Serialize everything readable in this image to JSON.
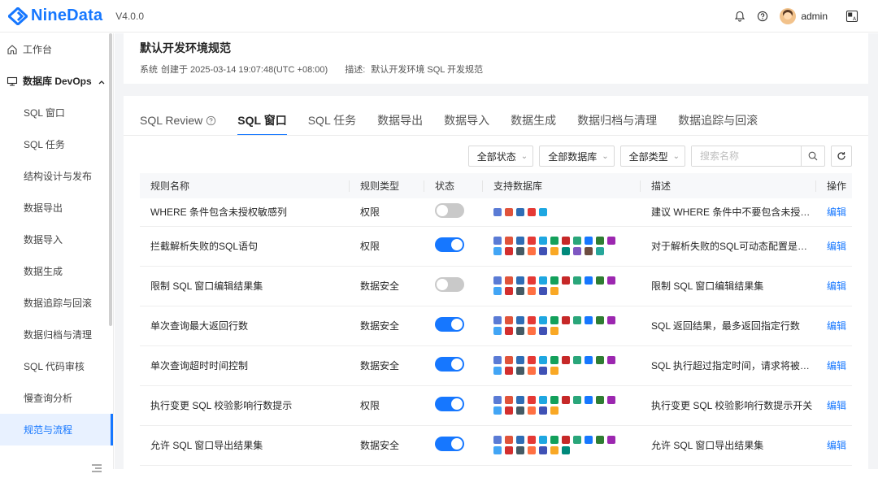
{
  "app": {
    "brand": "NineData",
    "version": "V4.0.0"
  },
  "header": {
    "user": "admin"
  },
  "sidebar": {
    "items": [
      {
        "label": "工作台",
        "level": 1
      },
      {
        "label": "数据库 DevOps",
        "level": 1,
        "expanded": true
      },
      {
        "label": "SQL 窗口",
        "level": 2
      },
      {
        "label": "SQL 任务",
        "level": 2
      },
      {
        "label": "结构设计与发布",
        "level": 2
      },
      {
        "label": "数据导出",
        "level": 2
      },
      {
        "label": "数据导入",
        "level": 2
      },
      {
        "label": "数据生成",
        "level": 2
      },
      {
        "label": "数据追踪与回滚",
        "level": 2
      },
      {
        "label": "数据归档与清理",
        "level": 2
      },
      {
        "label": "SQL 代码审核",
        "level": 2
      },
      {
        "label": "慢查询分析",
        "level": 2
      },
      {
        "label": "规范与流程",
        "level": 2,
        "active": true
      }
    ]
  },
  "spec": {
    "title": "默认开发环境规范",
    "creator": "系统",
    "created_at": "创建于 2025-03-14 19:07:48(UTC +08:00)",
    "desc_label": "描述:",
    "desc": "默认开发环境 SQL 开发规范"
  },
  "tabs": [
    {
      "label": "SQL Review",
      "help": true
    },
    {
      "label": "SQL 窗口",
      "active": true
    },
    {
      "label": "SQL 任务"
    },
    {
      "label": "数据导出"
    },
    {
      "label": "数据导入"
    },
    {
      "label": "数据生成"
    },
    {
      "label": "数据归档与清理"
    },
    {
      "label": "数据追踪与回滚"
    }
  ],
  "filters": {
    "status": "全部状态",
    "database": "全部数据库",
    "type": "全部类型",
    "search_placeholder": "搜索名称"
  },
  "table": {
    "columns": [
      "规则名称",
      "规则类型",
      "状态",
      "支持数据库",
      "描述",
      "操作"
    ],
    "rows": [
      {
        "name": "WHERE 条件包含未授权敏感列",
        "type": "权限",
        "enabled": false,
        "db_count": 5,
        "desc": "建议 WHERE 条件中不要包含未授权...",
        "action": "编辑"
      },
      {
        "name": "拦截解析失败的SQL语句",
        "type": "权限",
        "enabled": true,
        "db_count": 21,
        "desc": "对于解析失败的SQL可动态配置是否...",
        "action": "编辑"
      },
      {
        "name": "限制 SQL 窗口编辑结果集",
        "type": "数据安全",
        "enabled": false,
        "db_count": 17,
        "desc": "限制 SQL 窗口编辑结果集",
        "action": "编辑"
      },
      {
        "name": "单次查询最大返回行数",
        "type": "数据安全",
        "enabled": true,
        "db_count": 17,
        "desc": "SQL 返回结果，最多返回指定行数",
        "action": "编辑"
      },
      {
        "name": "单次查询超时时间控制",
        "type": "数据安全",
        "enabled": true,
        "db_count": 17,
        "desc": "SQL 执行超过指定时间，请求将被取消",
        "action": "编辑"
      },
      {
        "name": "执行变更 SQL 校验影响行数提示",
        "type": "权限",
        "enabled": true,
        "db_count": 17,
        "desc": "执行变更 SQL 校验影响行数提示开关",
        "action": "编辑"
      },
      {
        "name": "允许 SQL 窗口导出结果集",
        "type": "数据安全",
        "enabled": true,
        "db_count": 18,
        "desc": "允许 SQL 窗口导出结果集",
        "action": "编辑"
      }
    ]
  },
  "colors": {
    "accent": "#1677ff",
    "toggle_off": "#c9c9c9"
  },
  "db_icon_colors": [
    "#5a7bd5",
    "#e0533b",
    "#2f6db5",
    "#e53935",
    "#1ea7e1",
    "#13a05b",
    "#c62828",
    "#2aa67a",
    "#1677ff",
    "#2e7d32",
    "#9c27b0",
    "#42a5f5",
    "#d32f2f",
    "#455a64",
    "#ff7043",
    "#3f51b5",
    "#f9a825",
    "#00897b",
    "#7e57c2",
    "#6d4c41",
    "#26a69a"
  ]
}
